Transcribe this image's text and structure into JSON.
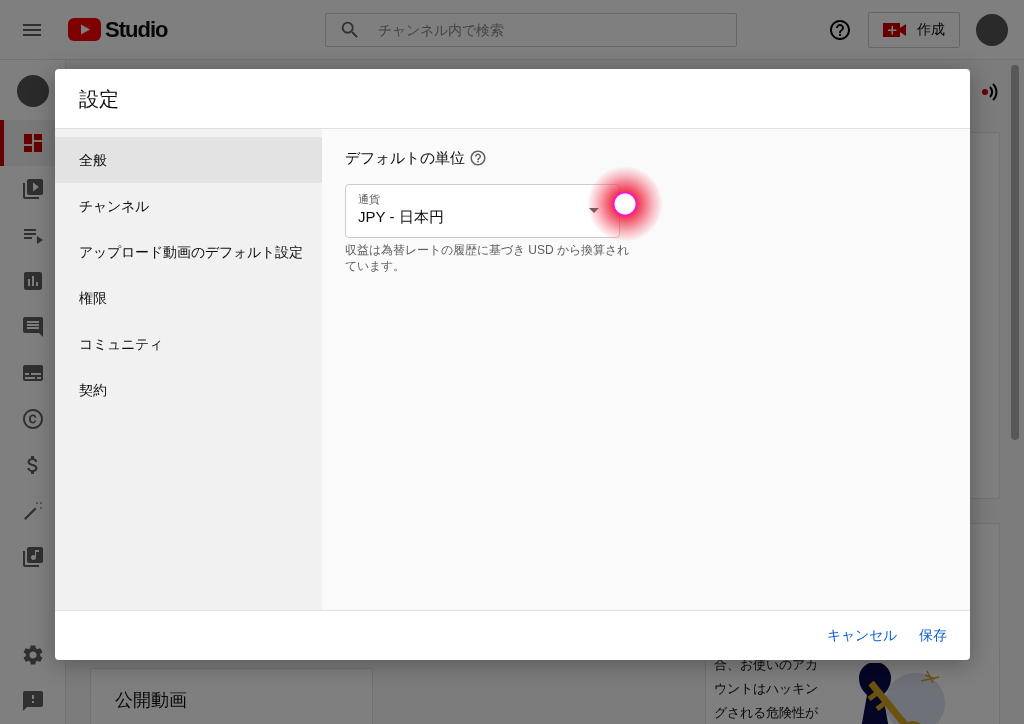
{
  "topbar": {
    "logo_text": "Studio",
    "search": {
      "placeholder": "チャンネル内で検索"
    },
    "create_button": "作成"
  },
  "sidebar": {
    "items": [
      {
        "selected": true
      },
      {
        "selected": false
      },
      {
        "selected": false
      },
      {
        "selected": false
      },
      {
        "selected": false
      },
      {
        "selected": false
      },
      {
        "selected": false
      },
      {
        "selected": false
      },
      {
        "selected": false
      },
      {
        "selected": false
      }
    ]
  },
  "background_cards": [
    {
      "title": "公開動画"
    },
    {
      "text": "合、お使いのアカウントはハッキングされる危険性が"
    }
  ],
  "dialog": {
    "title": "設定",
    "nav": [
      {
        "label": "全般",
        "selected": true
      },
      {
        "label": "チャンネル",
        "selected": false
      },
      {
        "label": "アップロード動画のデフォルト設定",
        "selected": false
      },
      {
        "label": "権限",
        "selected": false
      },
      {
        "label": "コミュニティ",
        "selected": false
      },
      {
        "label": "契約",
        "selected": false
      }
    ],
    "section_title": "デフォルトの単位",
    "currency": {
      "label": "通貨",
      "value": "JPY - 日本円"
    },
    "help_text": "収益は為替レートの履歴に基づき USD から換算されています。",
    "buttons": [
      {
        "label": "キャンセル"
      },
      {
        "label": "保存"
      }
    ]
  }
}
